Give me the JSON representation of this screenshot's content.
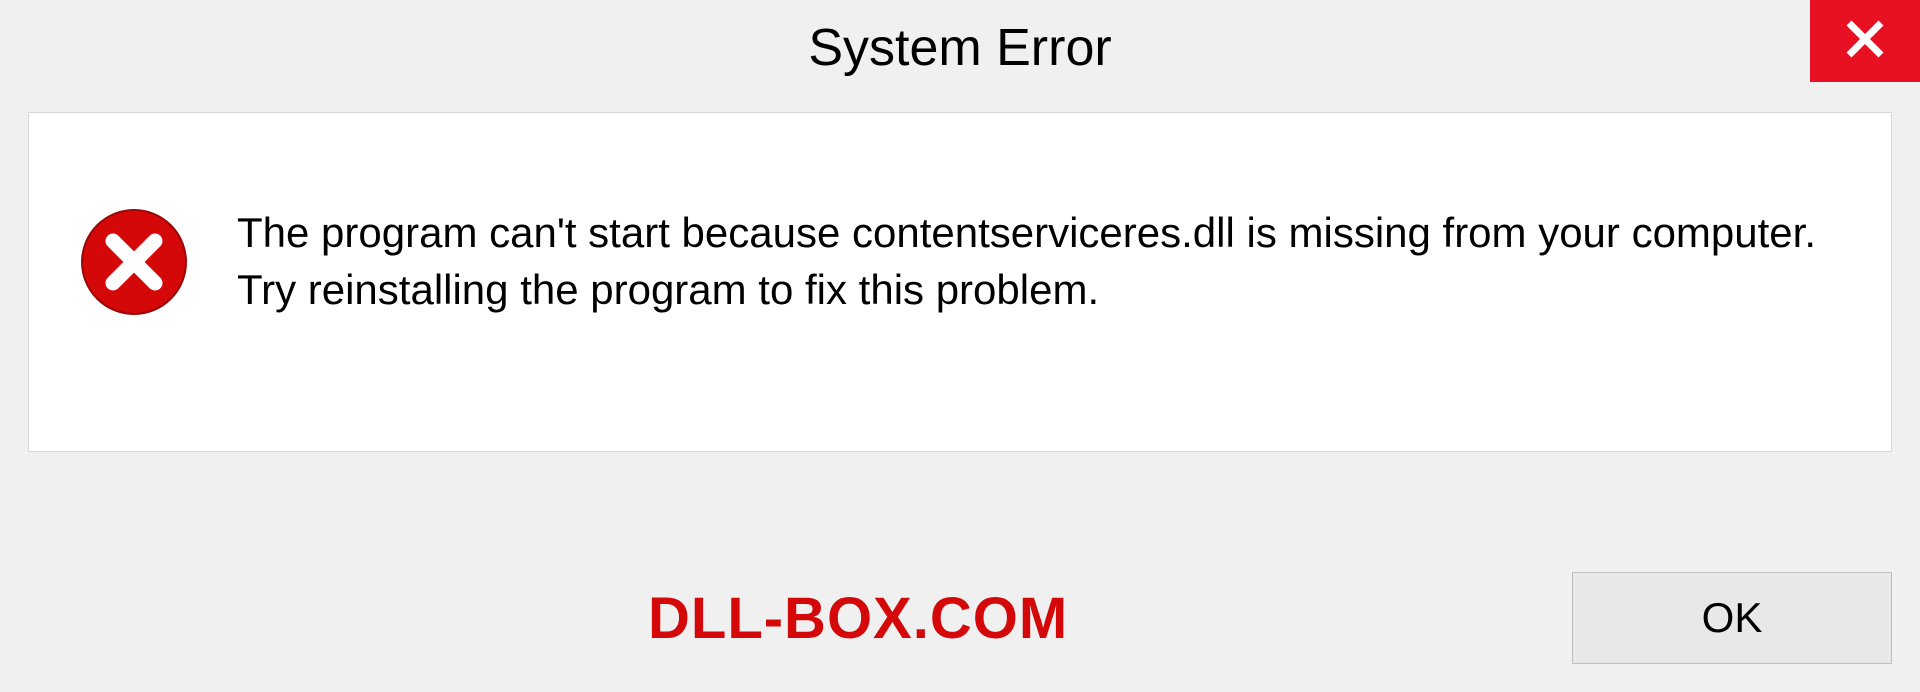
{
  "title": "System Error",
  "message": "The program can't start because contentserviceres.dll is missing from your computer. Try reinstalling the program to fix this problem.",
  "watermark": "DLL-BOX.COM",
  "ok_label": "OK",
  "colors": {
    "close_bg": "#e81123",
    "error_icon": "#d40808",
    "watermark": "#d40808"
  }
}
